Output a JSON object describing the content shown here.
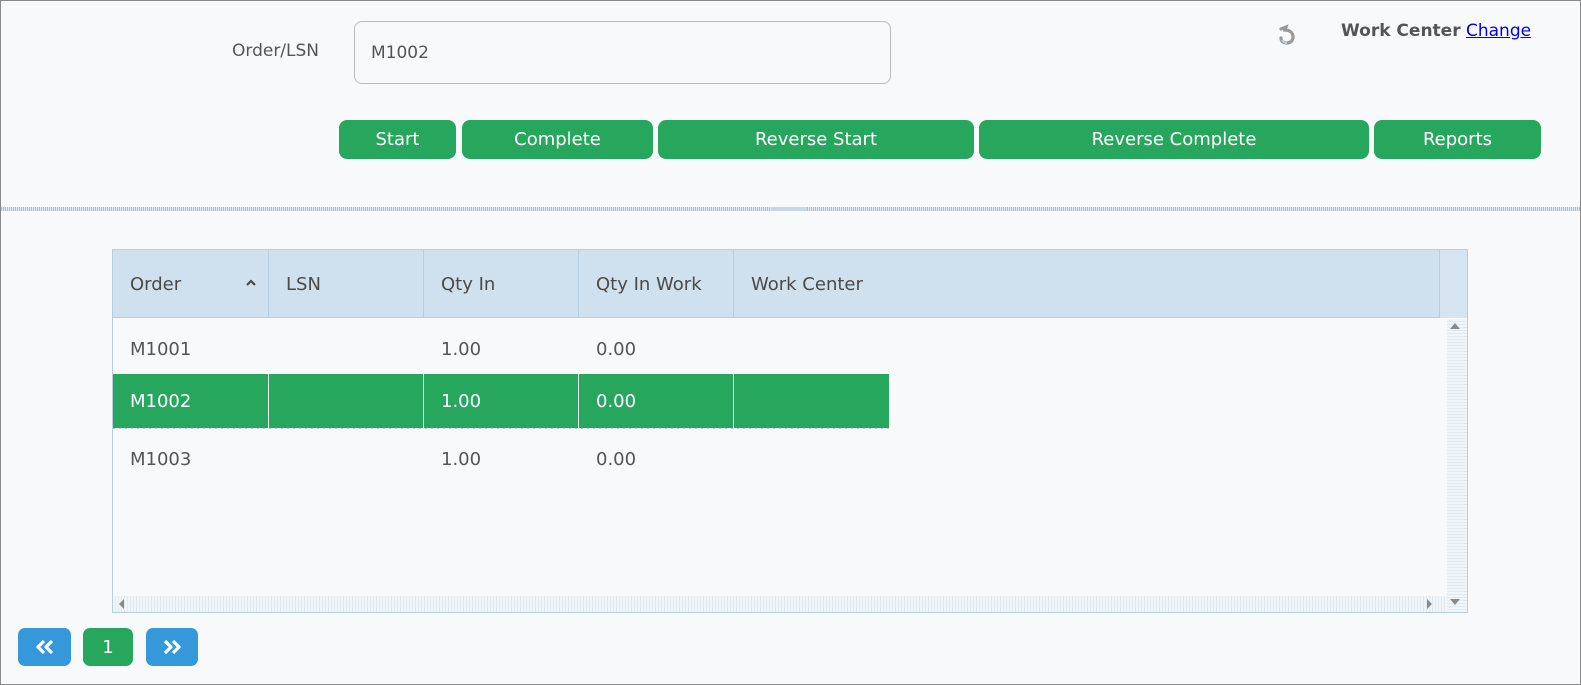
{
  "form": {
    "order_label": "Order/LSN",
    "order_value": "M1002",
    "order_placeholder": ""
  },
  "header": {
    "refresh_icon": "refresh-icon",
    "work_center_label": "Work Center",
    "work_center_link": "Change"
  },
  "toolbar": {
    "start": "Start",
    "complete": "Complete",
    "reverse_start": "Reverse Start",
    "reverse_complete": "Reverse Complete",
    "reports": "Reports"
  },
  "grid": {
    "columns": [
      {
        "label": "Order",
        "sort": "ascending"
      },
      {
        "label": "LSN"
      },
      {
        "label": "Qty In"
      },
      {
        "label": "Qty In Work"
      },
      {
        "label": "Work Center"
      }
    ],
    "rows": [
      {
        "order": "M1001",
        "lsn": "",
        "qty_in": "1.00",
        "qty_in_work": "0.00",
        "work_center": "",
        "selected": false
      },
      {
        "order": "M1002",
        "lsn": "",
        "qty_in": "1.00",
        "qty_in_work": "0.00",
        "work_center": "",
        "selected": true
      },
      {
        "order": "M1003",
        "lsn": "",
        "qty_in": "1.00",
        "qty_in_work": "0.00",
        "work_center": "",
        "selected": false
      }
    ]
  },
  "pager": {
    "prev_label": "«",
    "current_page": "1",
    "next_label": "»"
  },
  "colors": {
    "primary_green": "#27a75e",
    "pager_blue": "#3498db",
    "header_blue": "#cfe0ee",
    "link_blue": "#0000ee"
  }
}
